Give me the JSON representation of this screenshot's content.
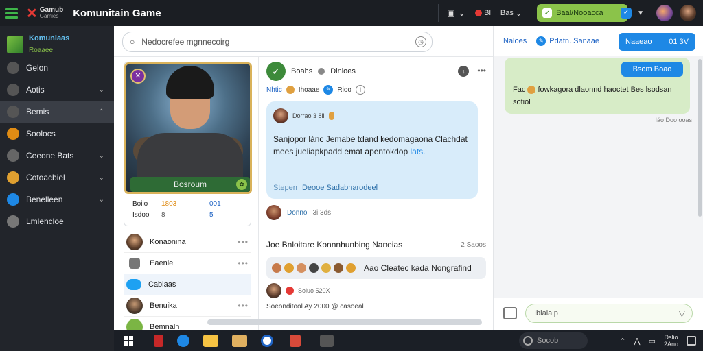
{
  "app": {
    "logo_text": "Gamub",
    "logo_sub": "Gamies",
    "title": "Komunitain Game"
  },
  "topbar": {
    "notif_label": "Bl",
    "user_label": "Bas",
    "status_pill": "Baal/Nooacca"
  },
  "sidebar": {
    "header_title": "Komuniaas",
    "header_sub": "Roaaee",
    "items": [
      {
        "label": "Gelon",
        "icon": "circle-icon",
        "color": "#555",
        "chevron": ""
      },
      {
        "label": "Aotis",
        "icon": "controller-icon",
        "color": "#555",
        "chevron": "⌄"
      },
      {
        "label": "Bemis",
        "icon": "square-icon",
        "color": "#555",
        "chevron": "⌃"
      },
      {
        "label": "Soolocs",
        "icon": "avatar-icon",
        "color": "#e08c14",
        "chevron": ""
      },
      {
        "label": "Ceeone Bats",
        "icon": "plus-icon",
        "color": "#666",
        "chevron": "⌄"
      },
      {
        "label": "Cotoacbiel",
        "icon": "coin-icon",
        "color": "#e0a030",
        "chevron": "⌄"
      },
      {
        "label": "Benelleen",
        "icon": "globe-icon",
        "color": "#1e88e5",
        "chevron": "⌄"
      },
      {
        "label": "Lmlencloe",
        "icon": "gear-icon",
        "color": "#777",
        "chevron": ""
      }
    ]
  },
  "search": {
    "placeholder": "Nedocrefee mgnnecoirg"
  },
  "character": {
    "name": "Bosroum",
    "stats": [
      {
        "k": "Boiio",
        "v1": "1803",
        "v2": "001"
      },
      {
        "k": "Isdoo",
        "v1": "8",
        "v2": "5"
      }
    ]
  },
  "friends": [
    {
      "name": "Konaonina"
    },
    {
      "name": "Eaenie"
    },
    {
      "name": "Cabiaas"
    },
    {
      "name": "Benuika"
    },
    {
      "name": "Bemnaln"
    }
  ],
  "post": {
    "author": "Boahs",
    "author_tag": "Dinloes",
    "tag1": "Nhtic",
    "tag2": "Ihoaae",
    "tag3": "Rioo",
    "bubble_meta": "Dorrao 3 8il",
    "bubble_text": "Sanjopor lánc Jemabe tdand kedomagaona Clachdat mees jueliapkpadd emat apentokdop",
    "bubble_link": "lats.",
    "bubble_foot_a": "Stepen",
    "bubble_foot_b": "Deooe Sadabnarodeel",
    "reply_name": "Donno",
    "reply_time": "3i 3ds"
  },
  "section": {
    "title": "Joe Bnloitare Konnnhunbing   Naneias",
    "meta": "2 Saoos",
    "emoji_text": "Aao Cleatec kada Nongrafind",
    "comment_meta": "Soiuo 520X",
    "date": "Soeonditool Ay 2000 @ casoeal"
  },
  "chat": {
    "tab1": "Naloes",
    "tab2": "Pdatn. Sanaae",
    "tab_button": "Naaeao",
    "tab_button_num": "01 3V",
    "msg_tag": "Bsom  Boao",
    "msg_text_a": "Fac",
    "msg_text_b": "fowkagora dlaonnd haoctet Bes lsodsan",
    "msg_text_c": "sotiol",
    "msg_time": "Iáo Doo ooas",
    "input_placeholder": "Iblalaip"
  },
  "taskbar": {
    "search_label": "Socob",
    "clock_line1": "Dslio",
    "clock_line2": "2Ano"
  }
}
